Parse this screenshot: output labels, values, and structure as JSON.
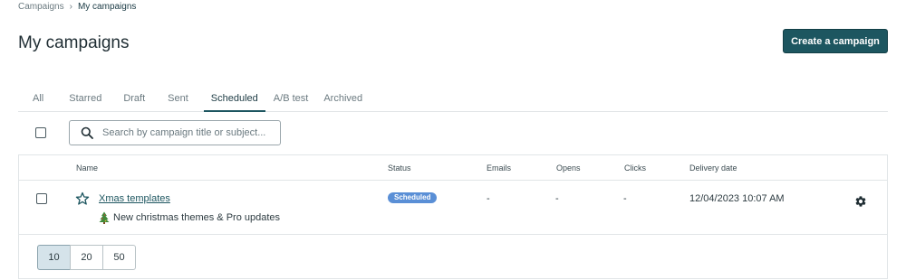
{
  "breadcrumb": {
    "parent": "Campaigns",
    "current": "My campaigns"
  },
  "page": {
    "title": "My campaigns",
    "create_label": "Create a campaign"
  },
  "tabs": [
    {
      "label": "All",
      "active": false
    },
    {
      "label": "Starred",
      "active": false
    },
    {
      "label": "Draft",
      "active": false
    },
    {
      "label": "Sent",
      "active": false
    },
    {
      "label": "Scheduled",
      "active": true
    },
    {
      "label": "A/B test",
      "active": false
    },
    {
      "label": "Archived",
      "active": false
    }
  ],
  "search": {
    "placeholder": "Search by campaign title or subject...",
    "icon": "search-icon"
  },
  "table": {
    "columns": {
      "name": "Name",
      "status": "Status",
      "emails": "Emails",
      "opens": "Opens",
      "clicks": "Clicks",
      "delivery": "Delivery date"
    },
    "rows": [
      {
        "title": "Xmas templates",
        "subject": "New christmas themes & Pro updates",
        "status": "Scheduled",
        "emails": "-",
        "opens": "-",
        "clicks": "-",
        "delivery_date": "12/04/2023 10:07 AM"
      }
    ]
  },
  "pagination": {
    "options": [
      "10",
      "20",
      "50"
    ],
    "selected": "10"
  },
  "colors": {
    "accent": "#1d5660",
    "badge": "#5a8fd6",
    "border": "#e1e5e7"
  }
}
